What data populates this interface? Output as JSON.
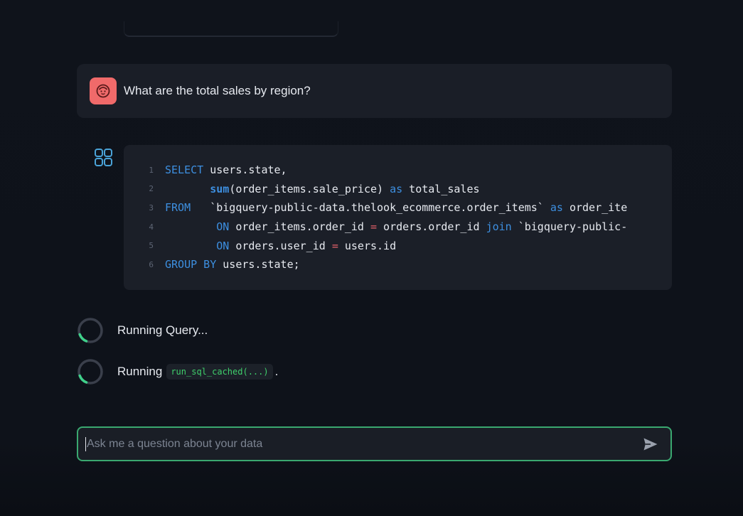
{
  "chat": {
    "user_message": "What are the total sales by region?",
    "sql_lines": [
      {
        "n": "1",
        "tokens": [
          {
            "t": "SELECT",
            "c": "kw"
          },
          {
            "t": " users.state,",
            "c": ""
          }
        ]
      },
      {
        "n": "2",
        "tokens": [
          {
            "t": "       ",
            "c": ""
          },
          {
            "t": "sum",
            "c": "fn"
          },
          {
            "t": "(order_items.sale_price) ",
            "c": ""
          },
          {
            "t": "as",
            "c": "kw"
          },
          {
            "t": " total_sales",
            "c": ""
          }
        ]
      },
      {
        "n": "3",
        "tokens": [
          {
            "t": "FROM",
            "c": "kw"
          },
          {
            "t": "   `bigquery-public-data.thelook_ecommerce.order_items` ",
            "c": ""
          },
          {
            "t": "as",
            "c": "kw"
          },
          {
            "t": " order_ite",
            "c": ""
          }
        ]
      },
      {
        "n": "4",
        "tokens": [
          {
            "t": "        ",
            "c": ""
          },
          {
            "t": "ON",
            "c": "kw"
          },
          {
            "t": " order_items.order_id ",
            "c": ""
          },
          {
            "t": "=",
            "c": "op"
          },
          {
            "t": " orders.order_id ",
            "c": ""
          },
          {
            "t": "join",
            "c": "kw"
          },
          {
            "t": " `bigquery-public-",
            "c": ""
          }
        ]
      },
      {
        "n": "5",
        "tokens": [
          {
            "t": "        ",
            "c": ""
          },
          {
            "t": "ON",
            "c": "kw"
          },
          {
            "t": " orders.user_id ",
            "c": ""
          },
          {
            "t": "=",
            "c": "op"
          },
          {
            "t": " users.id",
            "c": ""
          }
        ]
      },
      {
        "n": "6",
        "tokens": [
          {
            "t": "GROUP BY",
            "c": "kw"
          },
          {
            "t": " users.state;",
            "c": ""
          }
        ]
      }
    ],
    "status_running_query": "Running Query...",
    "status_running_prefix": "Running",
    "status_running_code": "run_sql_cached(...)",
    "status_running_suffix": "."
  },
  "input": {
    "placeholder": "Ask me a question about your data",
    "value": ""
  },
  "icons": {
    "user_avatar": "user-avatar-icon",
    "assistant_avatar": "app-grid-icon",
    "spinner": "loading-spinner-icon",
    "send": "send-icon"
  },
  "colors": {
    "background": "#0e1117",
    "user_avatar_bg": "#f06a6a",
    "accent_green": "#3aa870",
    "keyword_blue": "#3d8fe0",
    "operator_red": "#e8636b",
    "code_pill_green": "#3fcf6b"
  }
}
